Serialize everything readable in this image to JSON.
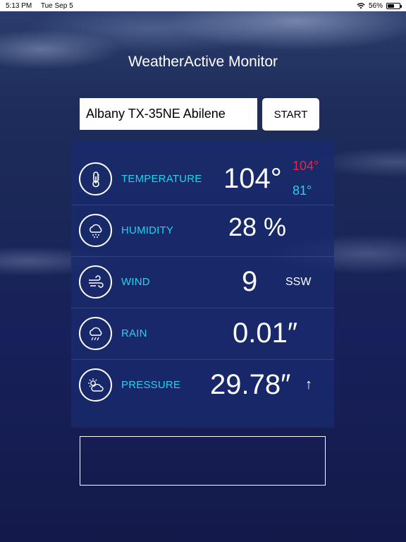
{
  "status_bar": {
    "time": "5:13 PM",
    "date": "Tue Sep 5",
    "battery": "56%",
    "battery_level": 0.56
  },
  "app": {
    "title": "WeatherActive Monitor"
  },
  "location_input": {
    "value": "Albany TX-35NE Abilene"
  },
  "start_button": {
    "label": "START"
  },
  "metrics": {
    "temperature": {
      "label": "TEMPERATURE",
      "value": "104°",
      "high": "104°",
      "low": "81°",
      "icon": "thermometer-icon"
    },
    "humidity": {
      "label": "HUMIDITY",
      "value": "28 %",
      "icon": "humidity-cloud-icon"
    },
    "wind": {
      "label": "WIND",
      "value": "9",
      "direction": "SSW",
      "icon": "wind-icon"
    },
    "rain": {
      "label": "RAIN",
      "value": "0.01″",
      "icon": "rain-cloud-icon"
    },
    "pressure": {
      "label": "PRESSURE",
      "value": "29.78″",
      "trend": "↑",
      "icon": "sun-cloud-icon"
    }
  },
  "colors": {
    "label_cyan": "#23d2f0",
    "high_red": "#e8254c",
    "panel": "#182a6e"
  }
}
